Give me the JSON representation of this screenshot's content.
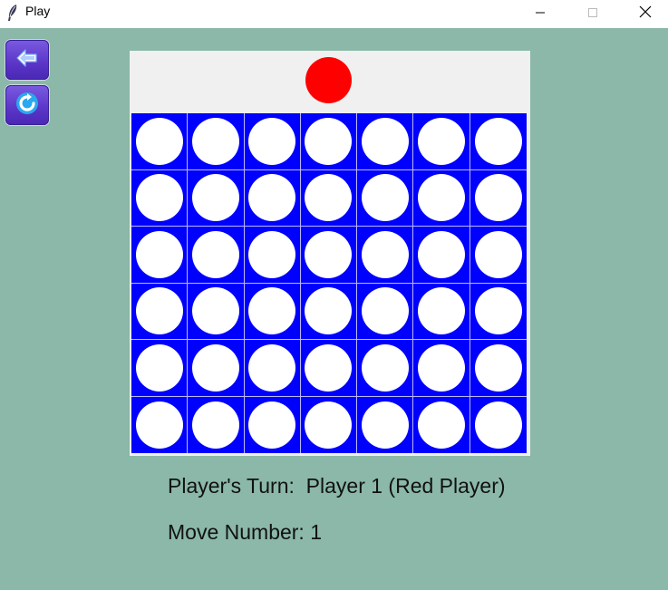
{
  "window": {
    "title": "Play",
    "icon": "feather-icon",
    "controls": [
      "minimize-icon",
      "maximize-icon",
      "close-icon"
    ]
  },
  "sidebar": {
    "back_icon": "back-arrow-icon",
    "restart_icon": "refresh-icon"
  },
  "board": {
    "columns": 7,
    "rows": 6,
    "current_disc_color": "#ff0000",
    "board_color": "#0000ff",
    "empty_slot_color": "#ffffff",
    "cells": [
      [
        "empty",
        "empty",
        "empty",
        "empty",
        "empty",
        "empty",
        "empty"
      ],
      [
        "empty",
        "empty",
        "empty",
        "empty",
        "empty",
        "empty",
        "empty"
      ],
      [
        "empty",
        "empty",
        "empty",
        "empty",
        "empty",
        "empty",
        "empty"
      ],
      [
        "empty",
        "empty",
        "empty",
        "empty",
        "empty",
        "empty",
        "empty"
      ],
      [
        "empty",
        "empty",
        "empty",
        "empty",
        "empty",
        "empty",
        "empty"
      ],
      [
        "empty",
        "empty",
        "empty",
        "empty",
        "empty",
        "empty",
        "empty"
      ]
    ]
  },
  "status": {
    "turn_text": "Player's Turn:  Player 1 (Red Player)",
    "move_text": "Move Number: 1"
  },
  "colors": {
    "background": "#8bb8a8",
    "accent_button": "#5a35c8"
  }
}
